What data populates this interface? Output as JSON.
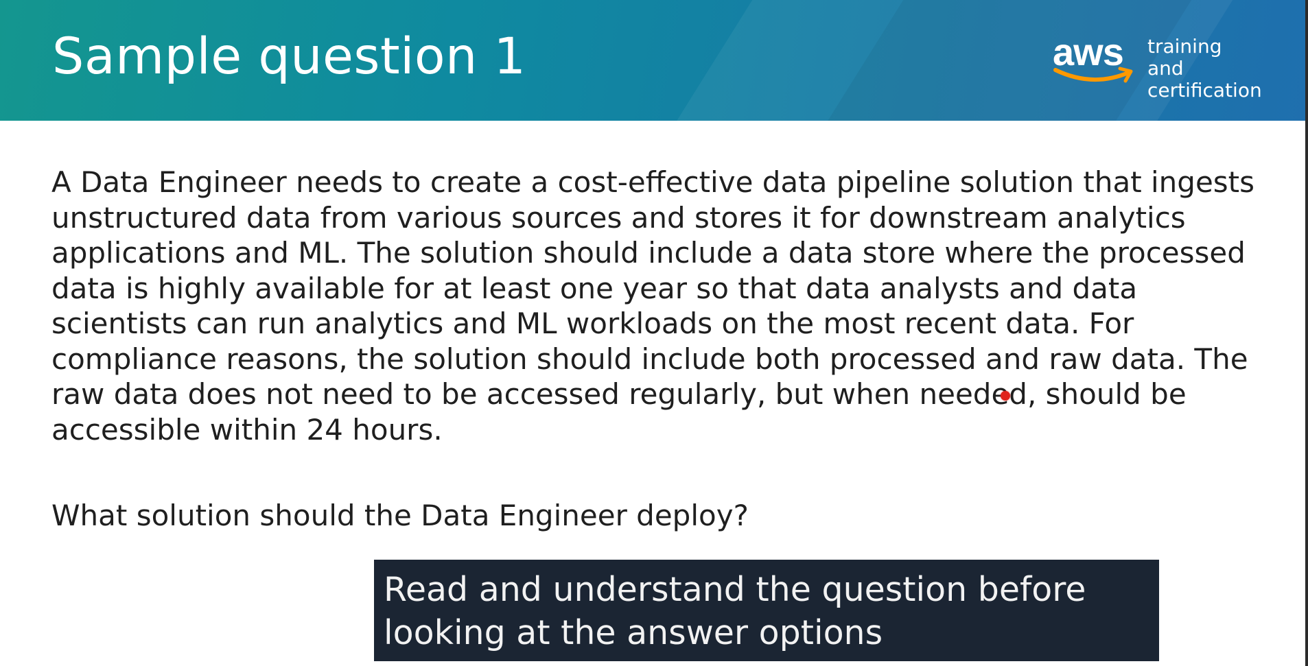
{
  "header": {
    "title": "Sample question 1",
    "brand": {
      "wordmark": "aws",
      "tagline": "training and certification",
      "accent_color": "#FF9900"
    },
    "colors": {
      "gradient_start": "#14968f",
      "gradient_end": "#1f6fae"
    }
  },
  "main": {
    "question_text": "A Data Engineer needs to create a cost-effective data pipeline solution that ingests unstructured data from various sources and stores it for downstream analytics applications and ML. The solution should include a data store where the processed data is highly available for at least one year so that data analysts and data scientists can run analytics and ML workloads on the most recent data. For compliance reasons, the solution should include both processed and raw data. The raw data does not need to be accessed regularly, but when needed, should be accessible within 24 hours.",
    "question_prompt": "What solution should the Data Engineer deploy?"
  },
  "caption": {
    "text": "Read and understand the question before looking at the answer options",
    "background": "#1b2533"
  },
  "pointer": {
    "color": "#e0231b"
  }
}
